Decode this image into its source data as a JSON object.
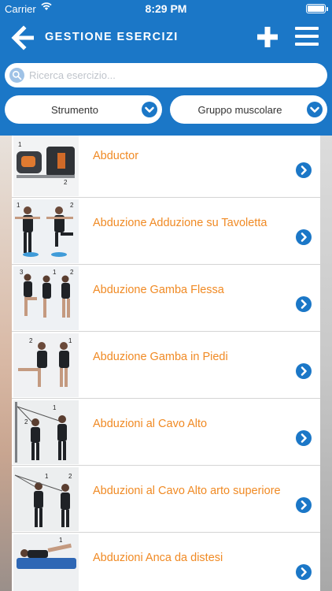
{
  "status_bar": {
    "carrier": "Carrier",
    "time": "8:29 PM",
    "battery_level": 1.0
  },
  "navbar": {
    "title": "GESTIONE ESERCIZI",
    "icons": [
      "back-arrow-icon",
      "plus-icon",
      "hamburger-menu-icon"
    ]
  },
  "search": {
    "placeholder": "Ricerca esercizio..."
  },
  "filters": {
    "instrument": "Strumento",
    "muscle_group": "Gruppo muscolare"
  },
  "colors": {
    "primary": "#1b77c7",
    "accent": "#f08a24",
    "chevron": "#1b77c7"
  },
  "exercises": [
    {
      "title": "Abductor",
      "thumb_labels": [
        "1",
        "2"
      ]
    },
    {
      "title": "Abduzione Adduzione su Tavoletta",
      "thumb_labels": [
        "1",
        "2"
      ]
    },
    {
      "title": "Abduzione Gamba Flessa",
      "thumb_labels": [
        "3",
        "1",
        "2"
      ]
    },
    {
      "title": "Abduzione Gamba in Piedi",
      "thumb_labels": [
        "2",
        "1"
      ]
    },
    {
      "title": "Abduzioni al Cavo Alto",
      "thumb_labels": [
        "1",
        "2"
      ]
    },
    {
      "title": "Abduzioni al Cavo Alto arto superiore",
      "thumb_labels": [
        "1",
        "2"
      ]
    },
    {
      "title": "Abduzioni Anca da distesi",
      "thumb_labels": [
        "1"
      ]
    }
  ]
}
